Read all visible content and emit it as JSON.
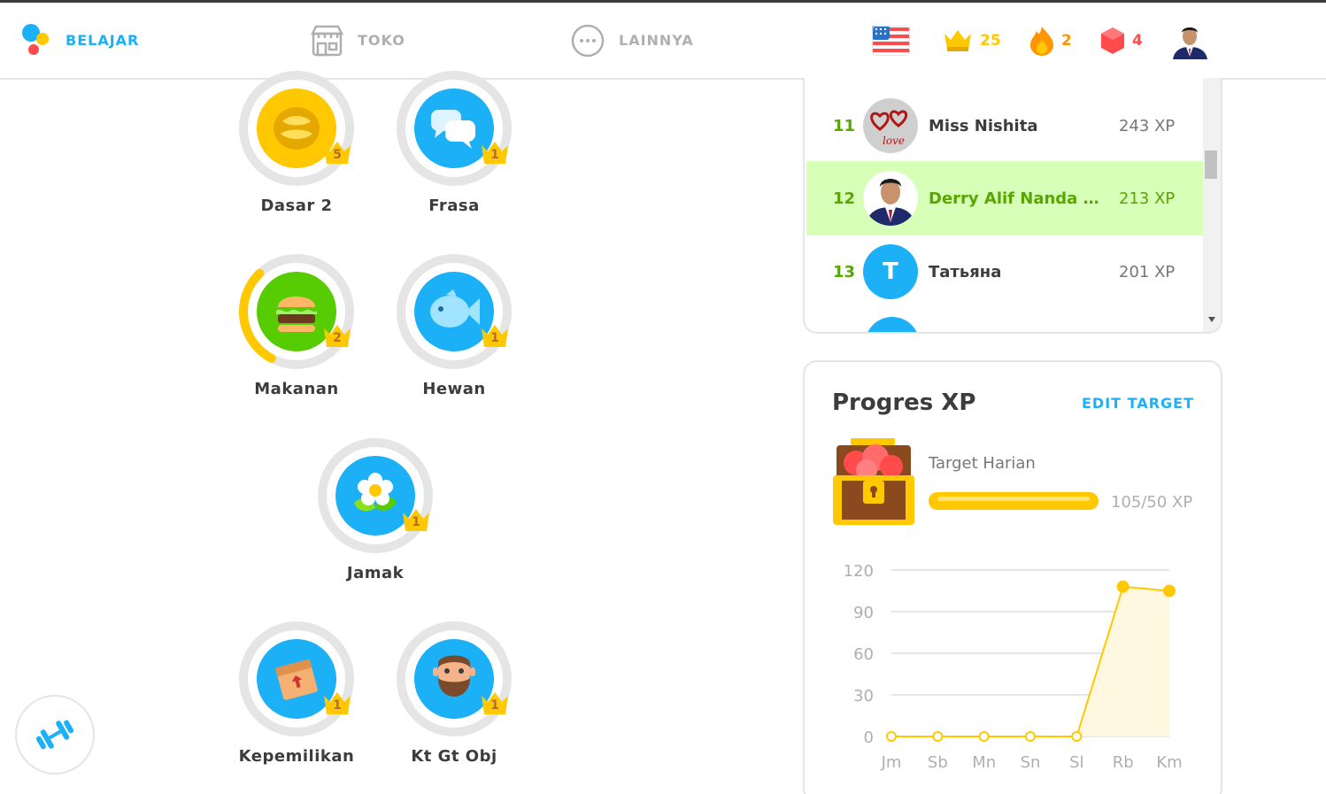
{
  "nav": {
    "learn": "BELAJAR",
    "shop": "TOKO",
    "more": "LAINNYA"
  },
  "stats": {
    "crowns": "25",
    "streak": "2",
    "gems": "4"
  },
  "skills": [
    {
      "name": "Dasar 2",
      "level": "5",
      "color": "#ffc800"
    },
    {
      "name": "Frasa",
      "level": "1",
      "color": "#1cb0f6"
    },
    {
      "name": "Makanan",
      "level": "2",
      "color": "#58cc02",
      "progress": 0.3
    },
    {
      "name": "Hewan",
      "level": "1",
      "color": "#1cb0f6"
    },
    {
      "name": "Jamak",
      "level": "1",
      "color": "#1cb0f6"
    },
    {
      "name": "Kepemilikan",
      "level": "1",
      "color": "#1cb0f6"
    },
    {
      "name": "Kt Gt Obj",
      "level": "1",
      "color": "#1cb0f6"
    }
  ],
  "leaderboard": [
    {
      "rank": "11",
      "name": "Miss Nishita",
      "xp": "243 XP"
    },
    {
      "rank": "12",
      "name": "Derry Alif Nanda Pr...",
      "xp": "213 XP"
    },
    {
      "rank": "13",
      "name": "Татьяна",
      "xp": "201 XP",
      "initial": "T"
    }
  ],
  "xp_progress": {
    "title": "Progres XP",
    "edit_target": "EDIT TARGET",
    "target_label": "Target Harian",
    "progress_text": "105/50 XP",
    "progress_fraction": 1.0
  },
  "chart_data": {
    "type": "line",
    "categories": [
      "Jm",
      "Sb",
      "Mn",
      "Sn",
      "Sl",
      "Rb",
      "Km"
    ],
    "values": [
      0,
      0,
      0,
      0,
      0,
      108,
      105
    ],
    "yticks": [
      0,
      30,
      60,
      90,
      120
    ],
    "ylim": [
      0,
      120
    ],
    "grid": true,
    "color": "#ffc800"
  }
}
